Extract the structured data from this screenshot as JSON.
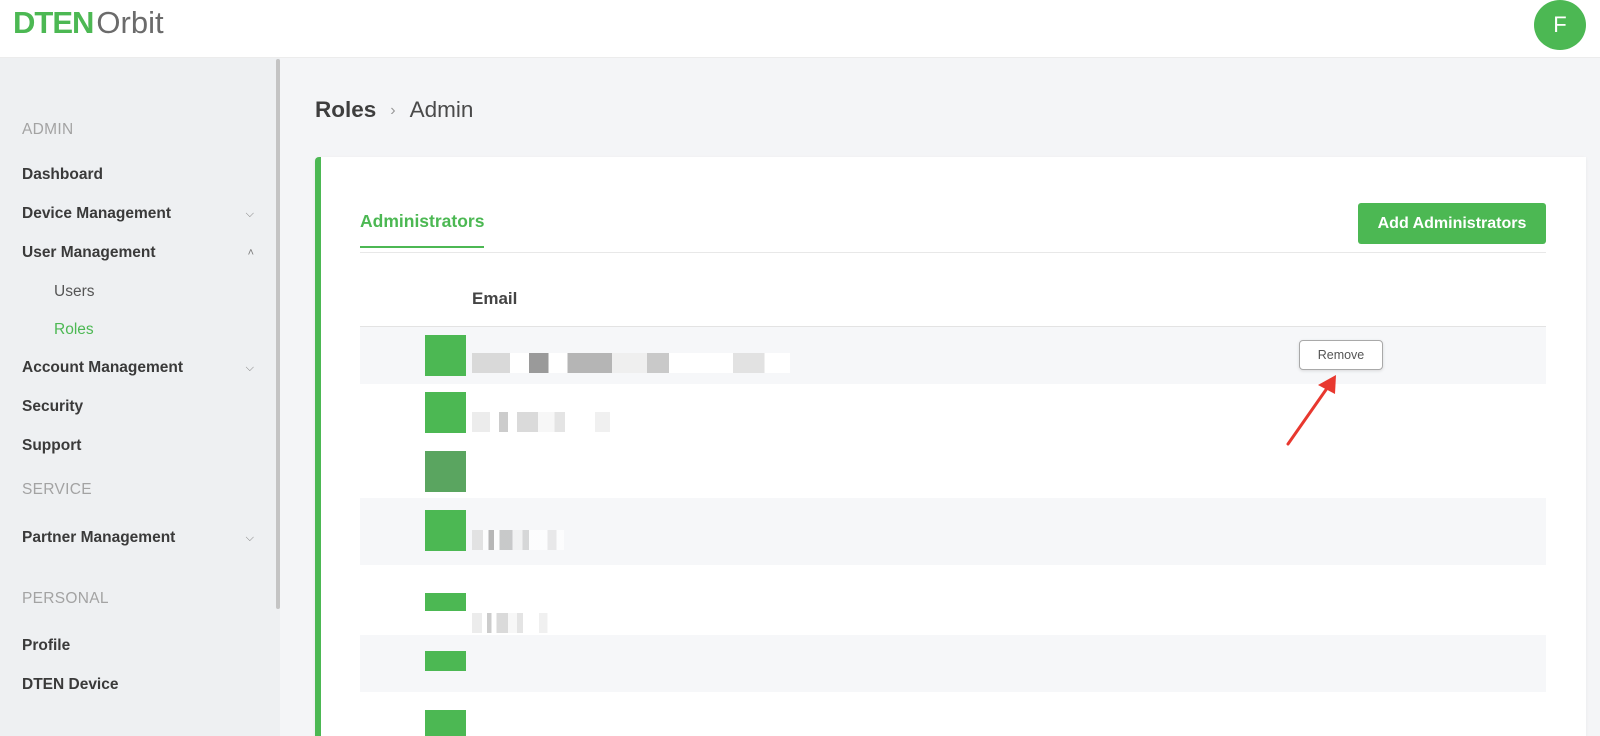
{
  "header": {
    "logo_brand": "DTEN",
    "logo_product": "Orbit",
    "avatar_initial": "F"
  },
  "sidebar": {
    "section_admin": "ADMIN",
    "section_service": "SERVICE",
    "section_personal": "PERSONAL",
    "items": [
      {
        "label": "Dashboard"
      },
      {
        "label": "Device Management",
        "icon": "chevron-down-icon"
      },
      {
        "label": "User Management",
        "icon": "chevron-up-icon"
      },
      {
        "label": "Users"
      },
      {
        "label": "Roles"
      },
      {
        "label": "Account Management",
        "icon": "chevron-down-icon"
      },
      {
        "label": "Security"
      },
      {
        "label": "Support"
      },
      {
        "label": "Partner Management",
        "icon": "chevron-down-icon"
      },
      {
        "label": "Profile"
      },
      {
        "label": "DTEN Device"
      }
    ],
    "active_item": "Roles"
  },
  "breadcrumb": {
    "parent": "Roles",
    "separator": "›",
    "current": "Admin"
  },
  "main": {
    "tab_label": "Administrators",
    "add_button_label": "Add Administrators",
    "email_column_header": "Email",
    "remove_button_label": "Remove"
  },
  "colors": {
    "accent": "#4cb853",
    "annotation_arrow": "#e8382f"
  }
}
